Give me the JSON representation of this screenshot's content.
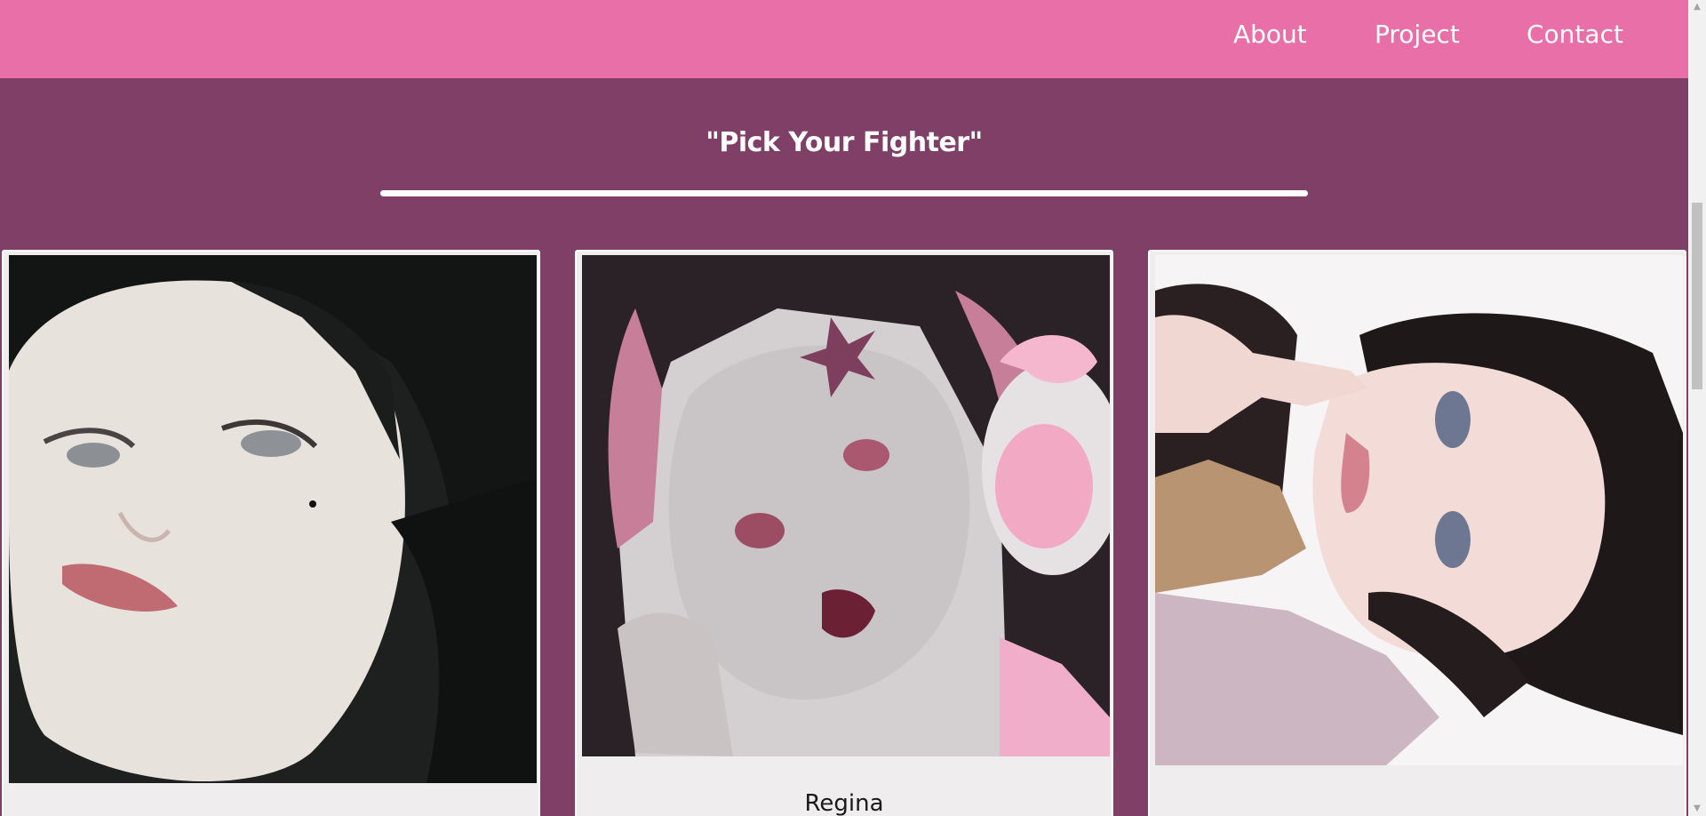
{
  "nav": {
    "links": [
      {
        "label": "About"
      },
      {
        "label": "Project"
      },
      {
        "label": "Contact"
      }
    ],
    "background": "#e86fa7"
  },
  "section": {
    "title": "\"Pick Your Fighter\"",
    "background": "#803f67"
  },
  "cards": [
    {
      "name": "",
      "image": "portrait-dark-hair-girl"
    },
    {
      "name": "Regina",
      "image": "portrait-pink-pigtails-headphones-girl"
    },
    {
      "name": "",
      "image": "portrait-girl-hand-on-face"
    }
  ],
  "scrollbar": {
    "up_icon": "triangle-up-icon",
    "down_icon": "triangle-down-icon"
  }
}
